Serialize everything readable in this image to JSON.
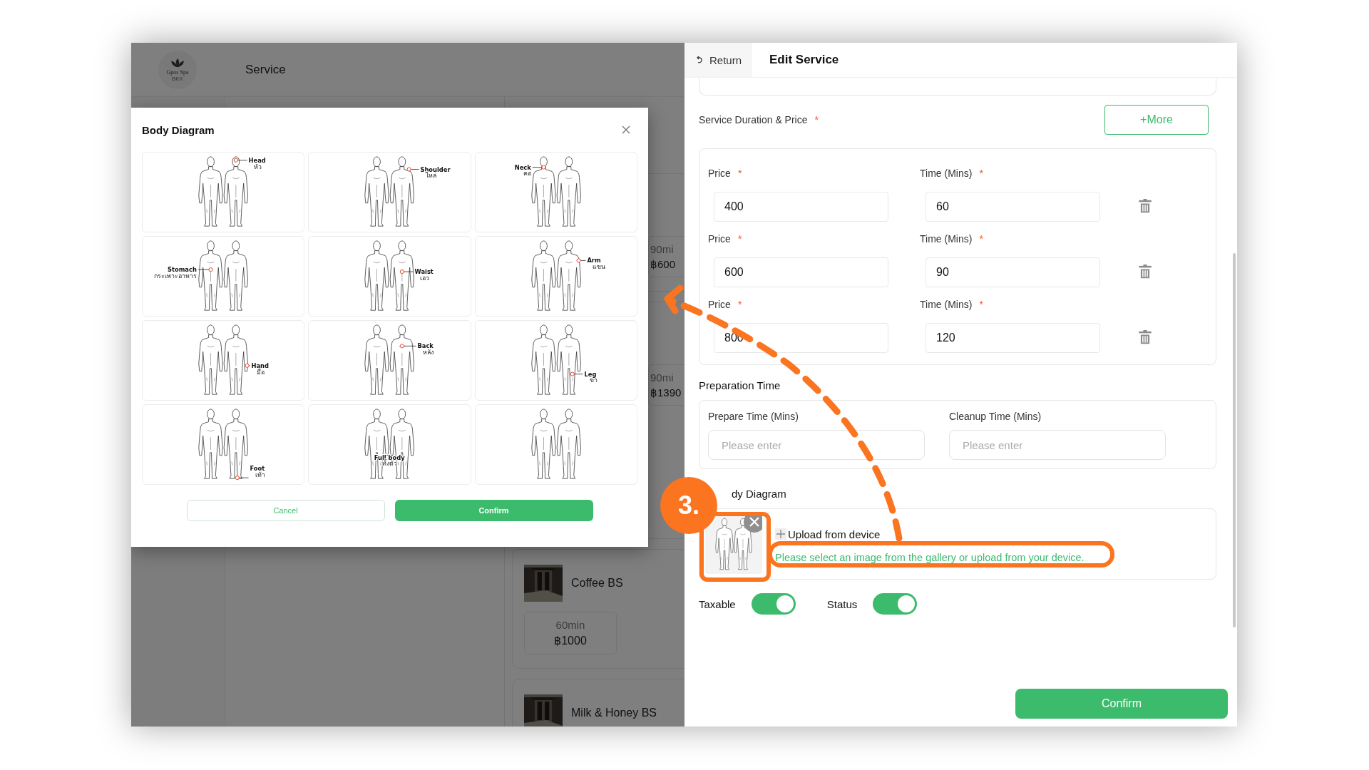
{
  "left_panel": {
    "logo": {
      "name": "Gpos Spa",
      "sub": "BKK"
    },
    "title": "Service",
    "cards": [
      {
        "chips": [
          {
            "time": "90mi",
            "price": "฿600"
          }
        ]
      },
      {
        "chips": [
          {
            "time": "90mi",
            "price": "฿1390"
          }
        ]
      },
      {
        "name": "Coffee BS",
        "image": {
          "kind": "picture"
        },
        "chips": [
          {
            "time": "60min",
            "price": "฿1000"
          }
        ]
      },
      {
        "name": "Milk & Honey BS",
        "image": {
          "kind": "picture"
        }
      }
    ]
  },
  "modal": {
    "title": "Body Diagram",
    "options": [
      {
        "kind": "head",
        "label": "Head",
        "label_th": "หัว"
      },
      {
        "kind": "shoulder",
        "label": "Shoulder",
        "label_th": "ไหล่"
      },
      {
        "kind": "neck",
        "label": "Neck",
        "label_th": "คอ"
      },
      {
        "kind": "stomach",
        "label": "Stomach",
        "label_th": "กระเพาะอาหาร"
      },
      {
        "kind": "waist",
        "label": "Waist",
        "label_th": "เอว"
      },
      {
        "kind": "arm",
        "label": "Arm",
        "label_th": "แขน"
      },
      {
        "kind": "hand",
        "label": "Hand",
        "label_th": "มือ"
      },
      {
        "kind": "back",
        "label": "Back",
        "label_th": "หลัง"
      },
      {
        "kind": "leg",
        "label": "Leg",
        "label_th": "ขา"
      },
      {
        "kind": "foot",
        "label": "Foot",
        "label_th": "เท้า"
      },
      {
        "kind": "full",
        "label": "Full body",
        "label_th": "ทั้งตัว"
      },
      {
        "kind": "none"
      }
    ],
    "cancel": "Cancel",
    "confirm": "Confirm"
  },
  "edit_panel": {
    "return": "Return",
    "title": "Edit Service",
    "duration_label": {
      "text": "Service Duration & Price",
      "mark": "*"
    },
    "more": "+More",
    "rows": [
      {
        "price_label": {
          "text": "Price",
          "mark": "*"
        },
        "price": "400",
        "time_label": {
          "text": "Time (Mins)",
          "mark": "*"
        },
        "time": "60"
      },
      {
        "price_label": {
          "text": "Price",
          "mark": "*"
        },
        "price": "600",
        "time_label": {
          "text": "Time (Mins)",
          "mark": "*"
        },
        "time": "90"
      },
      {
        "price_label": {
          "text": "Price",
          "mark": "*"
        },
        "price": "800",
        "time_label": {
          "text": "Time (Mins)",
          "mark": "*"
        },
        "time": "120"
      }
    ],
    "prep_title": "Preparation Time",
    "prep_fields": [
      {
        "label": "Prepare Time (Mins)",
        "placeholder": "Please enter"
      },
      {
        "label": "Cleanup Time (Mins)",
        "placeholder": "Please enter"
      }
    ],
    "diagram_label": "dy Diagram",
    "upload": "Upload from device",
    "hint": "Please select an image from the gallery or upload from your device.",
    "toggles": [
      {
        "label": "Taxable",
        "on": true
      },
      {
        "label": "Status",
        "on": true
      }
    ],
    "confirm": "Confirm"
  },
  "annotation": {
    "step": "3."
  }
}
